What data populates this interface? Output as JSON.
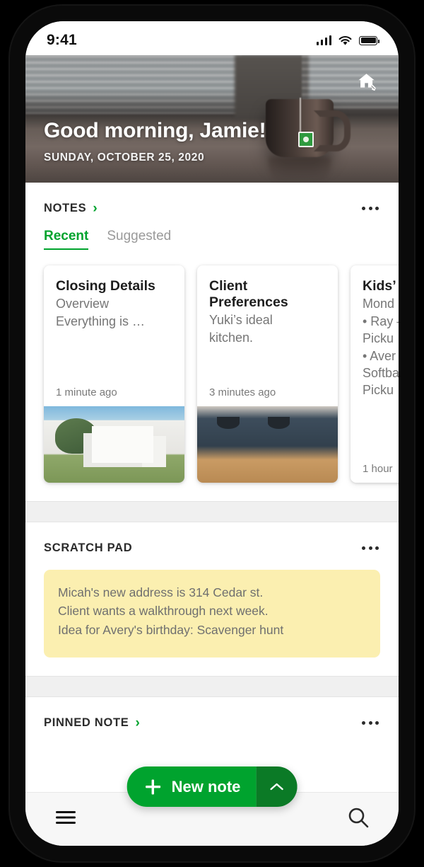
{
  "status_bar": {
    "time": "9:41",
    "signal_icon": "cellular-signal-icon",
    "wifi_icon": "wifi-icon",
    "battery_icon": "battery-full-icon"
  },
  "header": {
    "greeting": "Good morning, Jamie!",
    "date": "SUNDAY, OCTOBER 25, 2020",
    "action_icon": "home-edit-icon"
  },
  "notes_section": {
    "title": "NOTES",
    "chevron": "›",
    "overflow_icon": "overflow-menu-icon",
    "tabs": [
      {
        "label": "Recent",
        "active": true
      },
      {
        "label": "Suggested",
        "active": false
      }
    ],
    "cards": [
      {
        "title": "Closing Details",
        "subtitle": "Overview",
        "line2": "Everything is …",
        "time": "1 minute ago",
        "image": "modern-house-photo"
      },
      {
        "title": "Client Preferences",
        "subtitle": "Yuki’s ideal",
        "line2": "kitchen.",
        "time": "3 minutes ago",
        "image": "blue-kitchen-photo"
      },
      {
        "title": "Kids’",
        "subtitle": "Mond",
        "line2": "• Ray –",
        "line3": "Picku",
        "line4": "• Aver",
        "line5": "Softba",
        "line6": "Picku",
        "time": "1 hour",
        "image": "none"
      }
    ]
  },
  "scratch_pad": {
    "title": "SCRATCH PAD",
    "overflow_icon": "overflow-menu-icon",
    "lines": [
      "Micah's new address is 314 Cedar st.",
      "Client wants a walkthrough next week.",
      "Idea for Avery's birthday: Scavenger hunt"
    ]
  },
  "pinned_note": {
    "title": "PINNED NOTE",
    "chevron": "›",
    "overflow_icon": "overflow-menu-icon"
  },
  "fab": {
    "label": "New note",
    "plus_icon": "plus-icon",
    "expand_icon": "chevron-up-icon"
  },
  "bottom_bar": {
    "menu_icon": "hamburger-menu-icon",
    "search_icon": "search-icon"
  },
  "colors": {
    "accent_green": "#00a32e",
    "accent_green_dark": "#0b7a26",
    "scratch_pad_yellow": "#fbefb0",
    "band_gray": "#f0f0f0"
  }
}
